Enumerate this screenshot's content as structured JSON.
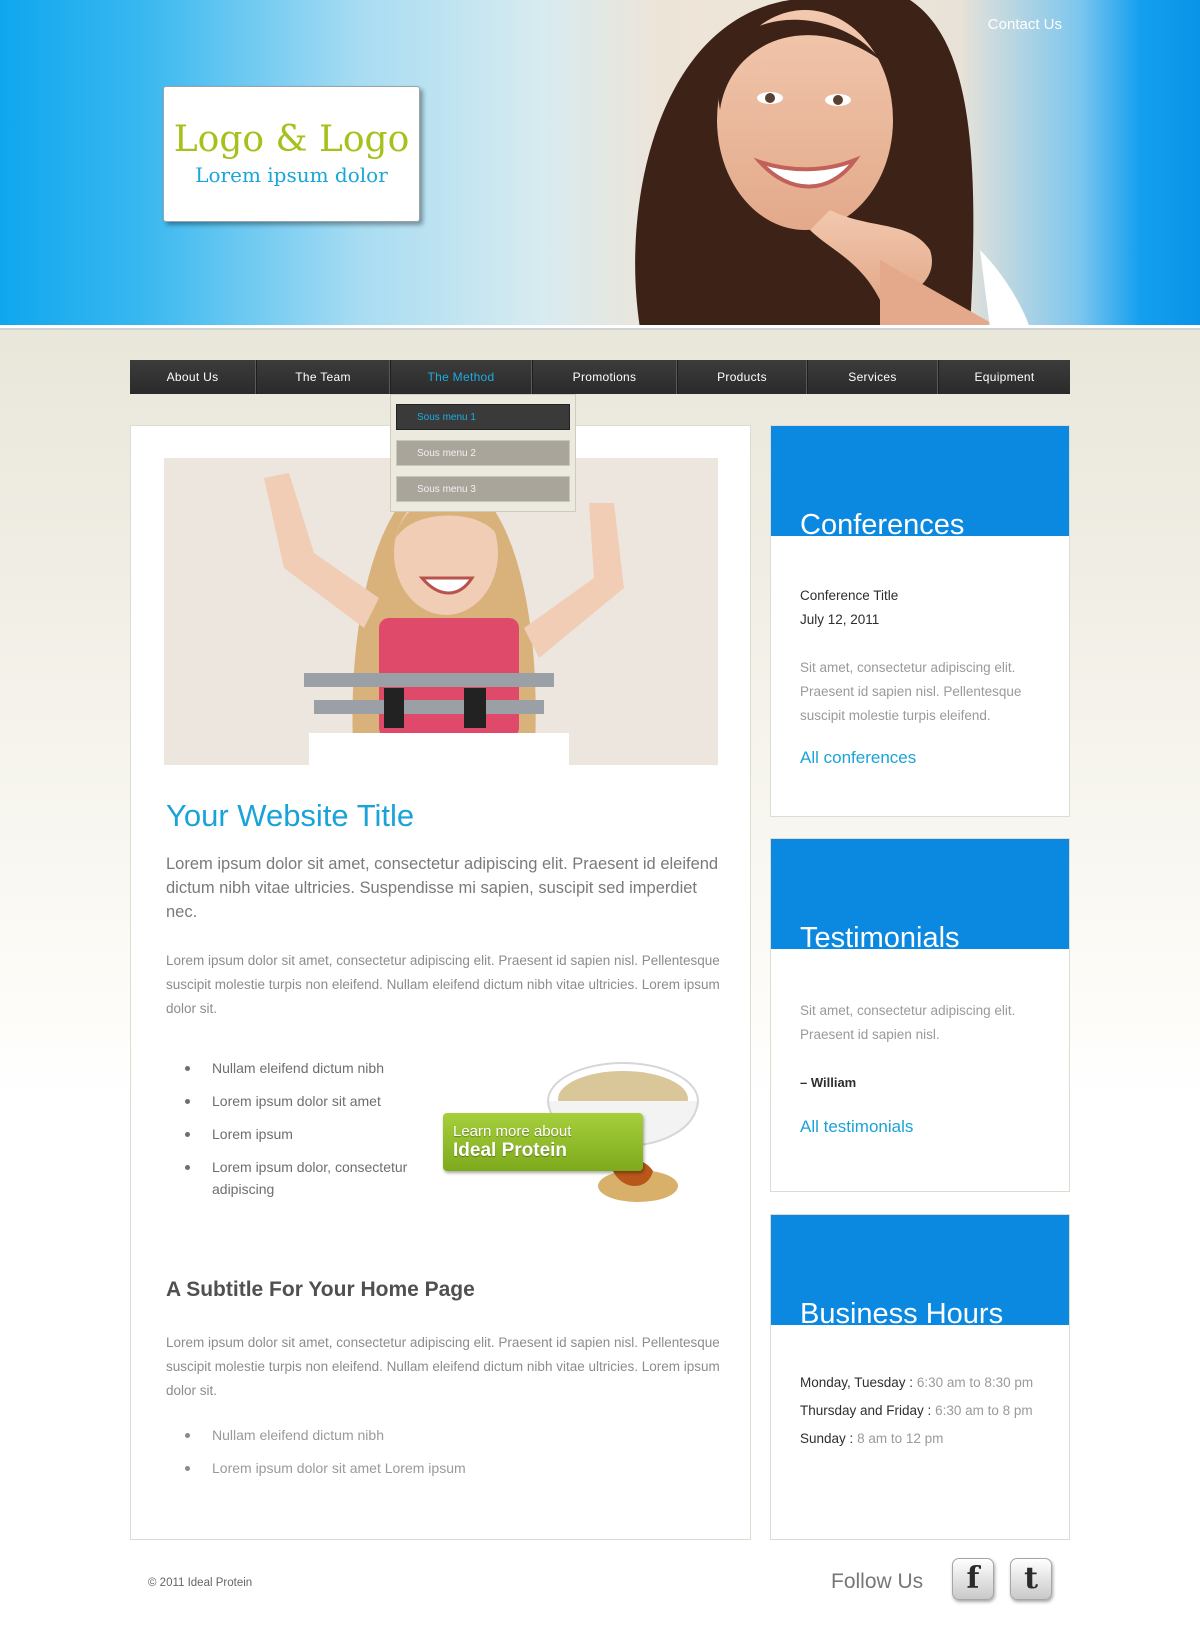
{
  "header": {
    "contact_label": "Contact Us",
    "logo_main": "Logo & Logo",
    "logo_sub": "Lorem ipsum dolor"
  },
  "nav": {
    "items": [
      "About Us",
      "The Team",
      "The Method",
      "Promotions",
      "Products",
      "Services",
      "Equipment"
    ],
    "active": "The Method",
    "submenu": [
      "Sous menu 1",
      "Sous menu 2",
      "Sous menu 3"
    ]
  },
  "main": {
    "title": "Your Website Title",
    "intro": "Lorem ipsum dolor sit amet, consectetur adipiscing elit. Praesent id eleifend dictum nibh vitae ultricies. Suspendisse mi sapien, suscipit sed imperdiet nec.",
    "paragraph1": "Lorem ipsum dolor sit amet, consectetur adipiscing elit. Praesent id sapien nisl. Pellentesque suscipit molestie turpis non eleifend. Nullam eleifend dictum nibh vitae ultricies. Lorem ipsum dolor sit.",
    "bullets1": [
      "Nullam eleifend dictum nibh",
      "Lorem ipsum dolor sit amet",
      "Lorem ipsum",
      "Lorem ipsum dolor, consectetur adipiscing"
    ],
    "promo_line1": "Learn more about",
    "promo_line2": "Ideal Protein",
    "subtitle": "A Subtitle For Your Home Page",
    "paragraph2": "Lorem ipsum dolor sit amet, consectetur adipiscing elit. Praesent id sapien nisl. Pellentesque suscipit molestie turpis non eleifend. Nullam eleifend dictum nibh vitae ultricies. Lorem ipsum dolor sit.",
    "bullets2": [
      "Nullam eleifend dictum nibh",
      "Lorem ipsum dolor sit amet Lorem ipsum"
    ]
  },
  "conferences": {
    "heading": "Conferences",
    "item_title": "Conference Title",
    "item_date": "July 12, 2011",
    "text": "Sit amet, consectetur adipiscing elit. Praesent id sapien nisl. Pellentesque suscipit molestie turpis eleifend.",
    "link": "All conferences"
  },
  "testimonials": {
    "heading": "Testimonials",
    "text": "Sit amet, consectetur adipiscing elit. Praesent id sapien nisl.",
    "author": "– William",
    "link": "All testimonials"
  },
  "hours": {
    "heading": "Business Hours",
    "rows": [
      {
        "day": "Monday, Tuesday :",
        "time": "6:30 am to 8:30 pm"
      },
      {
        "day": "Thursday and Friday :",
        "time": "6:30 am to 8 pm"
      },
      {
        "day": "Sunday :",
        "time": "8 am to 12 pm"
      }
    ]
  },
  "footer": {
    "copyright": "© 2011 Ideal Protein",
    "follow_label": "Follow Us",
    "social": [
      {
        "icon": "facebook-icon",
        "glyph": "f"
      },
      {
        "icon": "twitter-icon",
        "glyph": "t"
      }
    ]
  },
  "colors": {
    "accent": "#1aa3d8",
    "sidebar_header": "#0b88e0",
    "logo_green": "#a4c21b",
    "nav_bg": "#333333"
  }
}
